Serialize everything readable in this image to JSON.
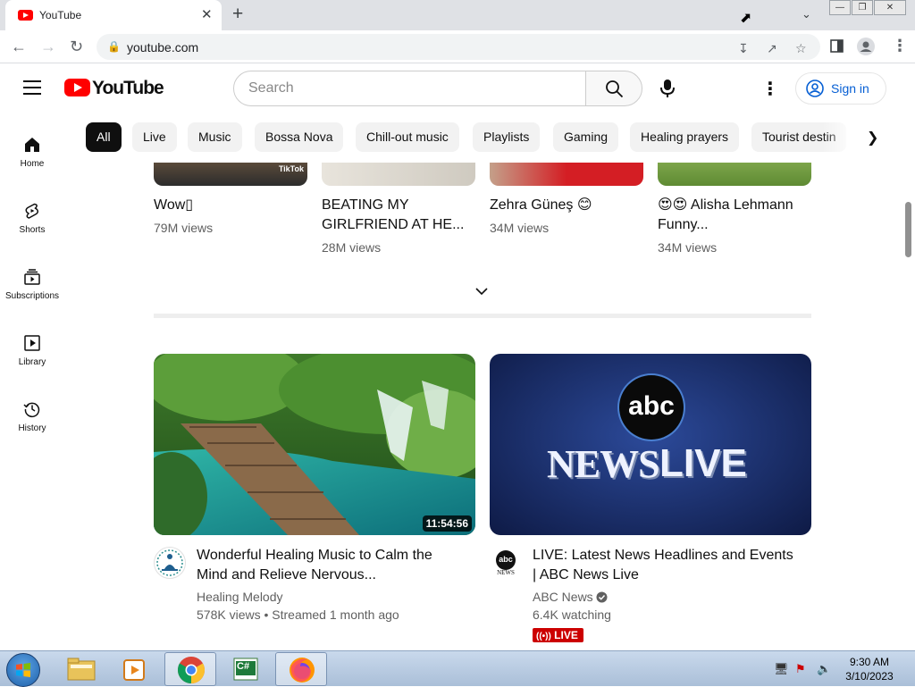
{
  "browser": {
    "tab_title": "YouTube",
    "tab_close": "✕",
    "new_tab": "+",
    "url": "youtube.com"
  },
  "header": {
    "wordmark": "YouTube",
    "search_placeholder": "Search",
    "signin_label": "Sign in"
  },
  "chips": [
    "All",
    "Live",
    "Music",
    "Bossa Nova",
    "Chill-out music",
    "Playlists",
    "Gaming",
    "Healing prayers",
    "Tourist destin"
  ],
  "sidebar": [
    {
      "label": "Home"
    },
    {
      "label": "Shorts"
    },
    {
      "label": "Subscriptions"
    },
    {
      "label": "Library"
    },
    {
      "label": "History"
    }
  ],
  "shorts": [
    {
      "title": "Wow▯",
      "views": "79M views",
      "watermark": "TikTok"
    },
    {
      "title": "BEATING MY GIRLFRIEND AT HE...",
      "views": "28M views"
    },
    {
      "title": "Zehra Güneş 😊",
      "views": "34M views"
    },
    {
      "title": "😍😍 Alisha Lehmann Funny...",
      "views": "34M views"
    }
  ],
  "videos": [
    {
      "title": "Wonderful Healing Music to Calm the Mind and Relieve Nervous...",
      "channel": "Healing Melody",
      "meta": "578K views • Streamed 1 month ago",
      "duration": "11:54:56"
    },
    {
      "title": "LIVE: Latest News Headlines and Events | ABC News Live",
      "channel": "ABC News",
      "meta": "6.4K watching",
      "badge": "LIVE",
      "thumb_logo": "abc",
      "thumb_text_a": "NEWS",
      "thumb_text_b": "LIVE",
      "avatar_text": "abc",
      "avatar_sub": "NEWS"
    }
  ],
  "taskbar": {
    "time": "9:30 AM",
    "date": "3/10/2023"
  },
  "colors": {
    "yt_red": "#ff0000",
    "link_blue": "#065fd4",
    "live_red": "#cc0000"
  }
}
